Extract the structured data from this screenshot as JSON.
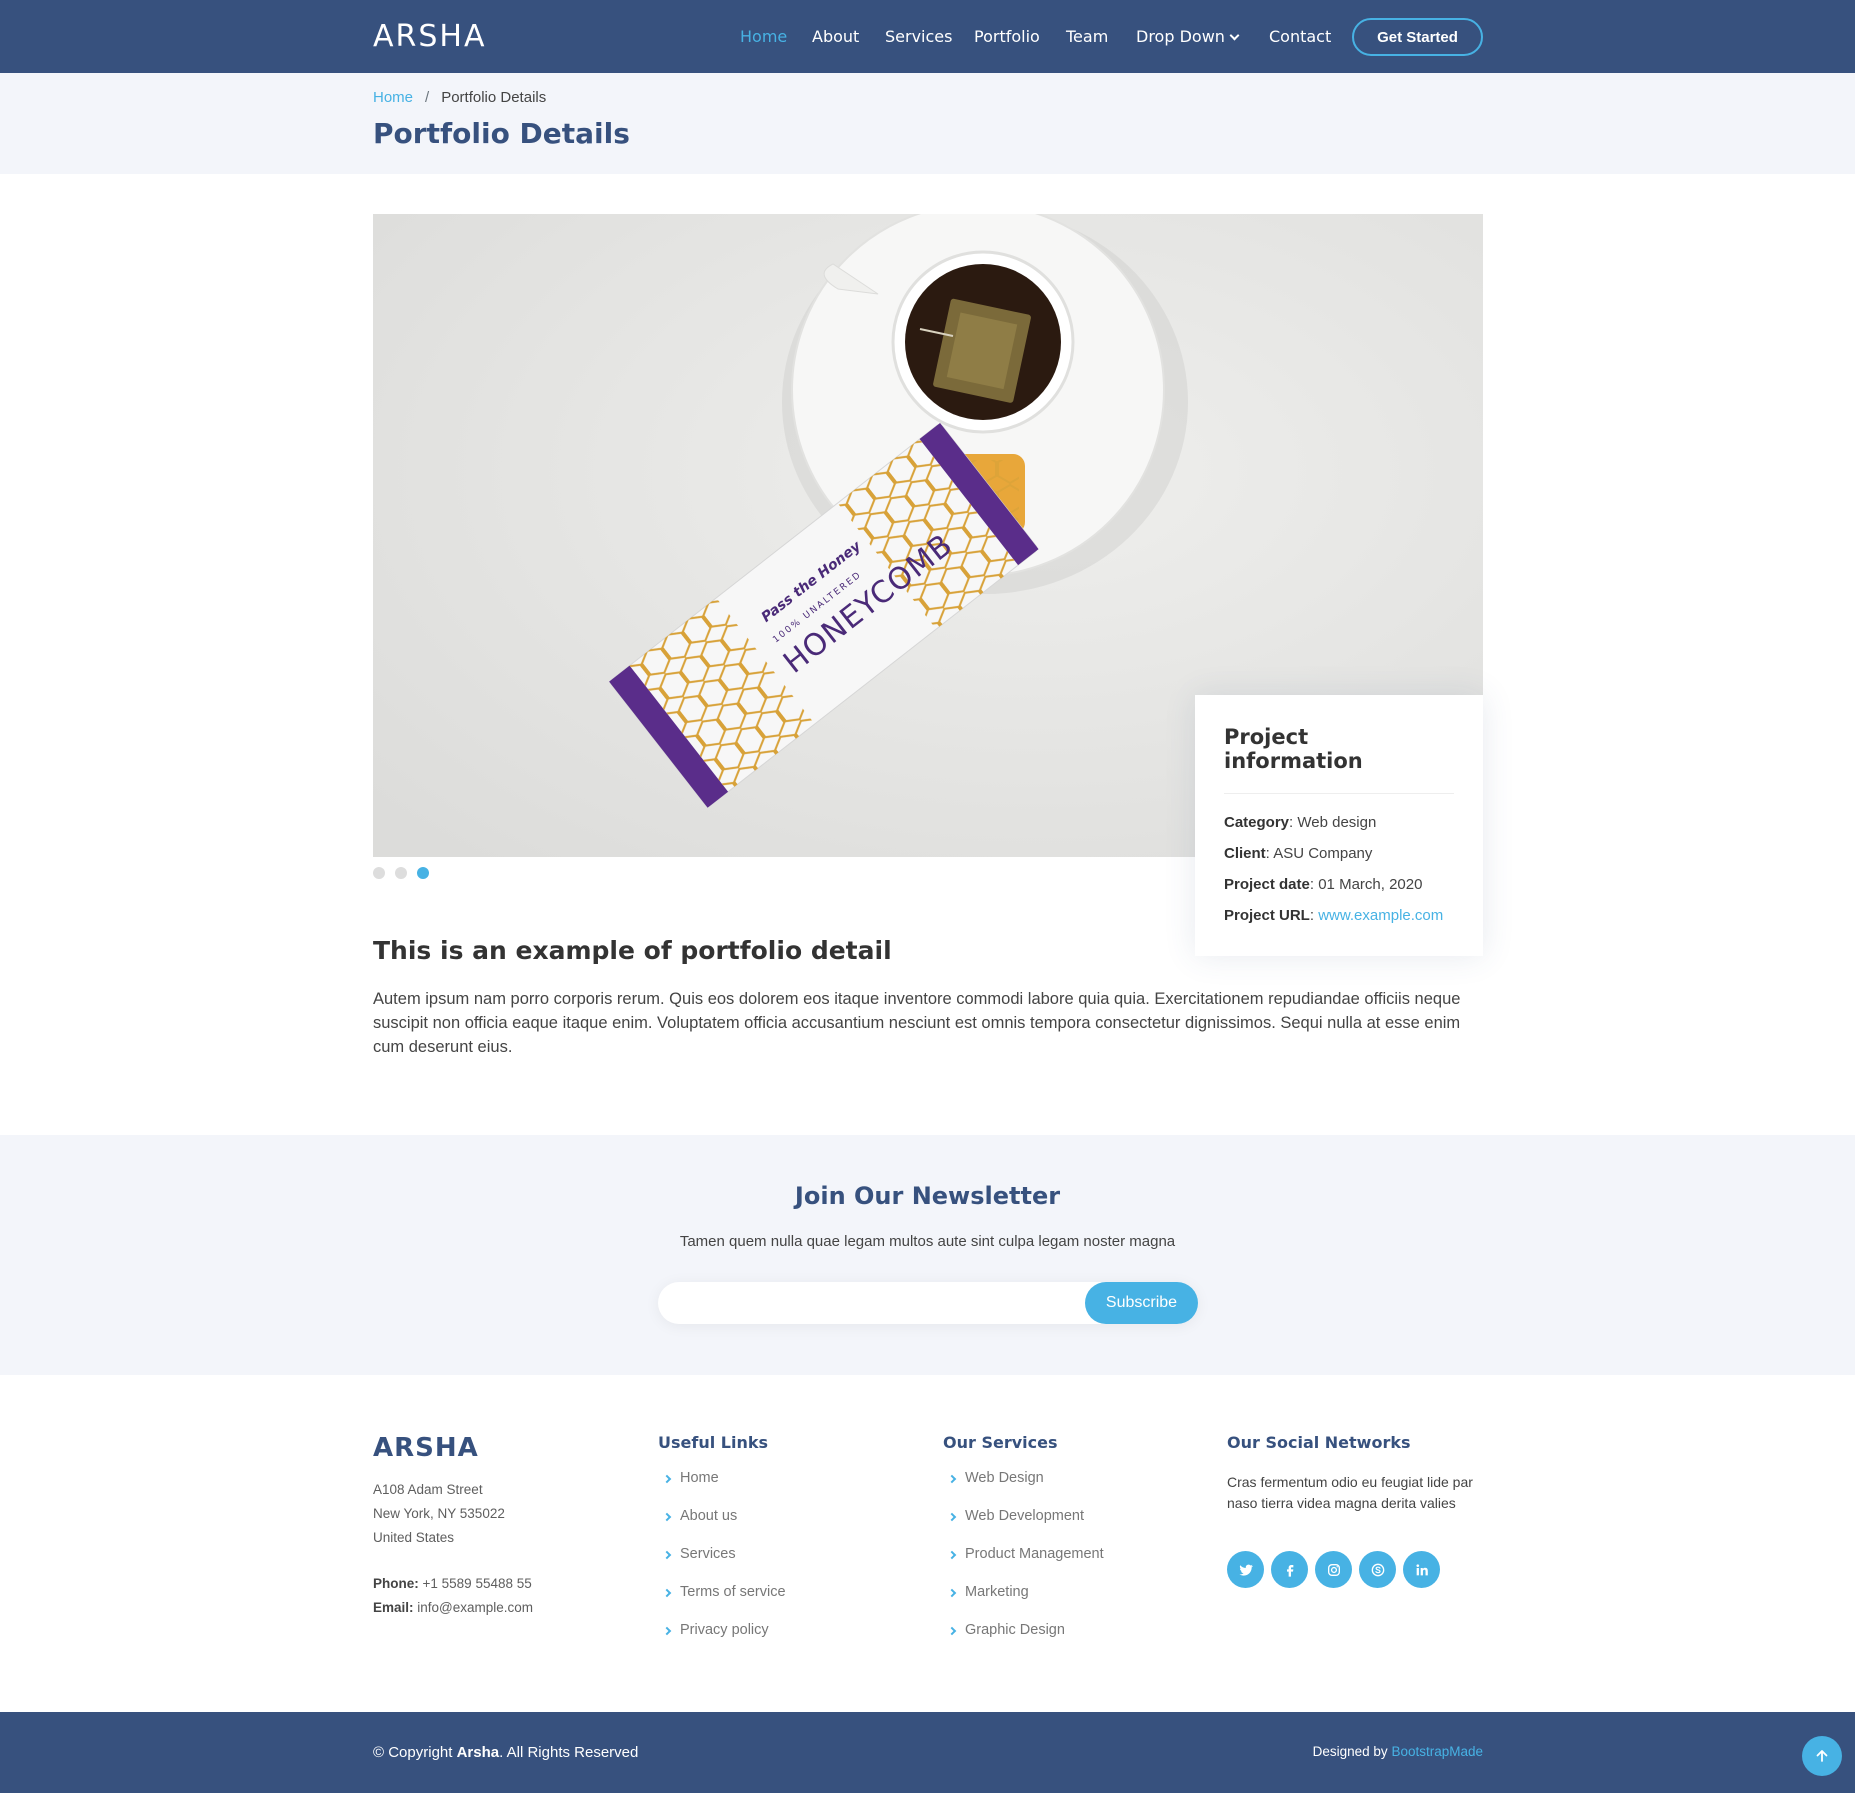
{
  "header": {
    "logo": "ARSHA",
    "nav": [
      {
        "label": "Home",
        "active": true
      },
      {
        "label": "About"
      },
      {
        "label": "Services"
      },
      {
        "label": "Portfolio"
      },
      {
        "label": "Team"
      },
      {
        "label": "Drop Down"
      },
      {
        "label": "Contact"
      }
    ],
    "cta": "Get Started"
  },
  "breadcrumbs": {
    "home": "Home",
    "separator": "/",
    "current": "Portfolio Details",
    "title": "Portfolio Details"
  },
  "slider": {
    "image_text": {
      "brand": "Pass the Honey",
      "tagline": "100% UNALTERED",
      "product": "HONEYCOMB"
    },
    "dots": 3,
    "active_dot": 3
  },
  "project_info": {
    "title": "Project information",
    "category_label": "Category",
    "category": "Web design",
    "client_label": "Client",
    "client": "ASU Company",
    "date_label": "Project date",
    "date": "01 March, 2020",
    "url_label": "Project URL",
    "url": "www.example.com"
  },
  "description": {
    "title": "This is an example of portfolio detail",
    "text": "Autem ipsum nam porro corporis rerum. Quis eos dolorem eos itaque inventore commodi labore quia quia. Exercitationem repudiandae officiis neque suscipit non officia eaque itaque enim. Voluptatem officia accusantium nesciunt est omnis tempora consectetur dignissimos. Sequi nulla at esse enim cum deserunt eius."
  },
  "newsletter": {
    "title": "Join Our Newsletter",
    "subtitle": "Tamen quem nulla quae legam multos aute sint culpa legam noster magna",
    "input_value": "",
    "button": "Subscribe"
  },
  "footer": {
    "logo": "ARSHA",
    "address": [
      "A108 Adam Street",
      "New York, NY 535022",
      "United States"
    ],
    "phone_label": "Phone:",
    "phone": "+1 5589 55488 55",
    "email_label": "Email:",
    "email": "info@example.com",
    "useful_links_title": "Useful Links",
    "useful_links": [
      "Home",
      "About us",
      "Services",
      "Terms of service",
      "Privacy policy"
    ],
    "services_title": "Our Services",
    "services": [
      "Web Design",
      "Web Development",
      "Product Management",
      "Marketing",
      "Graphic Design"
    ],
    "social_title": "Our Social Networks",
    "social_text": "Cras fermentum odio eu feugiat lide par naso tierra videa magna derita valies",
    "social_icons": [
      "twitter-icon",
      "facebook-icon",
      "instagram-icon",
      "skype-icon",
      "linkedin-icon"
    ],
    "copyright_prefix": "© Copyright ",
    "copyright_brand": "Arsha",
    "copyright_suffix": ". All Rights Reserved",
    "credits_prefix": "Designed by ",
    "credits_link": "BootstrapMade"
  },
  "colors": {
    "primary": "#37517e",
    "accent": "#47b2e4",
    "light_bg": "#f3f5fa"
  }
}
